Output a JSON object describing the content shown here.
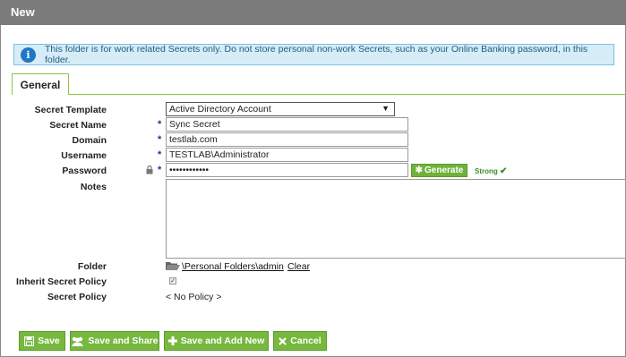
{
  "window": {
    "title": "New"
  },
  "info": {
    "message": "This folder is for work related Secrets only. Do not store personal non-work Secrets, such as your Online Banking password, in this folder."
  },
  "tabs": [
    {
      "label": "General"
    }
  ],
  "form": {
    "secret_template": {
      "label": "Secret Template",
      "value": "Active Directory Account"
    },
    "secret_name": {
      "label": "Secret Name",
      "value": "Sync Secret"
    },
    "domain": {
      "label": "Domain",
      "value": "testlab.com"
    },
    "username": {
      "label": "Username",
      "value": "TESTLAB\\Administrator"
    },
    "password": {
      "label": "Password",
      "value": "••••••••••••",
      "generate_label": "Generate",
      "strength": "Strong"
    },
    "notes": {
      "label": "Notes",
      "value": ""
    },
    "folder": {
      "label": "Folder",
      "path": "\\Personal Folders\\admin",
      "clear_label": "Clear"
    },
    "inherit_secret_policy": {
      "label": "Inherit Secret Policy",
      "checked": true
    },
    "secret_policy": {
      "label": "Secret Policy",
      "value": "< No Policy >"
    }
  },
  "buttons": {
    "save": "Save",
    "save_and_share": "Save and Share",
    "save_and_add_new": "Save and Add New",
    "cancel": "Cancel"
  },
  "colors": {
    "accent": "#77b83e",
    "titlebar": "#7b7b7b",
    "info_bg": "#d6ecf7",
    "info_icon": "#1f77c4"
  }
}
